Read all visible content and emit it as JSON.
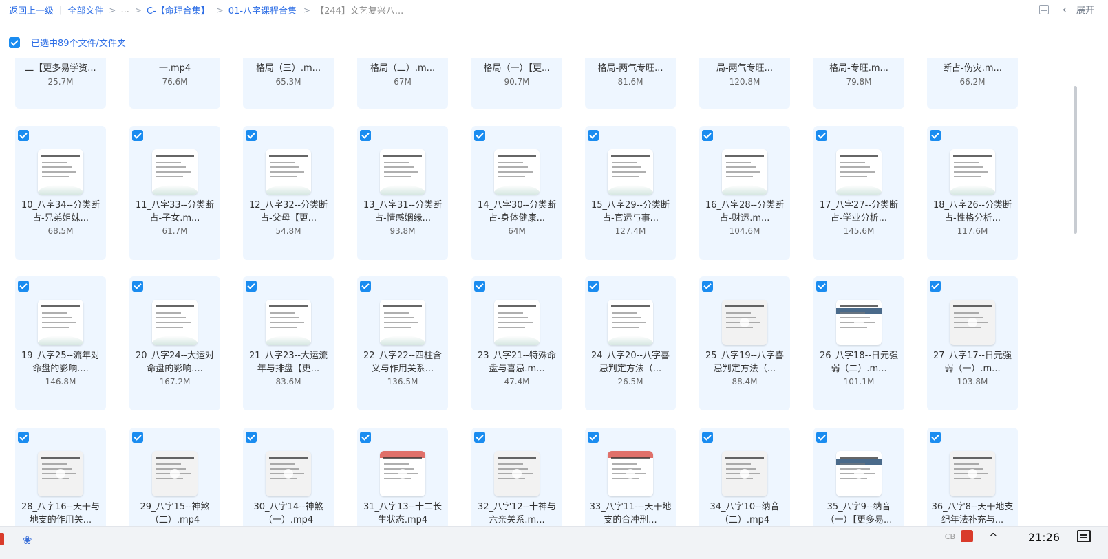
{
  "breadcrumb": {
    "back": "返回上一级",
    "all_files": "全部文件",
    "ellipsis": "...",
    "folder1": "C-【命理合集】",
    "folder2": "01-八字课程合集",
    "current": "【244】文艺复兴八..."
  },
  "toolbar": {
    "expand_label": "展开"
  },
  "selection": {
    "label": "已选中89个文件/文件夹"
  },
  "partial_row": [
    {
      "name": "二【更多易学资...",
      "size": "25.7M"
    },
    {
      "name": "一.mp4",
      "size": "76.6M"
    },
    {
      "name": "格局（三）.m...",
      "size": "65.3M"
    },
    {
      "name": "格局（二）.m...",
      "size": "67M"
    },
    {
      "name": "格局（一）【更...",
      "size": "90.7M"
    },
    {
      "name": "格局-两气专旺...",
      "size": "81.6M"
    },
    {
      "name": "局-两气专旺...",
      "size": "120.8M"
    },
    {
      "name": "格局-专旺.m...",
      "size": "79.8M"
    },
    {
      "name": "断占-伤灾.m...",
      "size": "66.2M"
    }
  ],
  "rows": [
    [
      {
        "name": "10_八字34--分类断占-兄弟姐妹...",
        "size": "68.5M"
      },
      {
        "name": "11_八字33--分类断占-子女.m...",
        "size": "61.7M"
      },
      {
        "name": "12_八字32--分类断占-父母【更...",
        "size": "54.8M"
      },
      {
        "name": "13_八字31--分类断占-情感姻缘...",
        "size": "93.8M"
      },
      {
        "name": "14_八字30--分类断占-身体健康...",
        "size": "64M"
      },
      {
        "name": "15_八字29--分类断占-官运与事...",
        "size": "127.4M"
      },
      {
        "name": "16_八字28--分类断占-财运.m...",
        "size": "104.6M"
      },
      {
        "name": "17_八字27--分类断占-学业分析...",
        "size": "145.6M"
      },
      {
        "name": "18_八字26--分类断占-性格分析...",
        "size": "117.6M"
      }
    ],
    [
      {
        "name": "19_八字25--流年对命盘的影响....",
        "size": "146.8M"
      },
      {
        "name": "20_八字24--大运对命盘的影响....",
        "size": "167.2M"
      },
      {
        "name": "21_八字23--大运流年与排盘【更...",
        "size": "83.6M"
      },
      {
        "name": "22_八字22--四柱含义与作用关系...",
        "size": "136.5M"
      },
      {
        "name": "23_八字21--特殊命盘与喜忌.m...",
        "size": "47.4M"
      },
      {
        "name": "24_八字20--八字喜忌判定方法（...",
        "size": "26.5M"
      },
      {
        "name": "25_八字19--八字喜忌判定方法（...",
        "size": "88.4M"
      },
      {
        "name": "26_八字18--日元强弱（二）.m...",
        "size": "101.1M"
      },
      {
        "name": "27_八字17--日元强弱（一）.m...",
        "size": "103.8M"
      }
    ],
    [
      {
        "name": "28_八字16--天干与地支的作用关...",
        "size": ""
      },
      {
        "name": "29_八字15--神煞（二）.mp4",
        "size": ""
      },
      {
        "name": "30_八字14--神煞（一）.mp4",
        "size": ""
      },
      {
        "name": "31_八字13--十二长生状态.mp4",
        "size": ""
      },
      {
        "name": "32_八字12--十神与六亲关系.m...",
        "size": ""
      },
      {
        "name": "33_八字11---天干地支的合冲刑...",
        "size": ""
      },
      {
        "name": "34_八字10--纳音（二）.mp4",
        "size": ""
      },
      {
        "name": "35_八字9--纳音（一）【更多易...",
        "size": ""
      },
      {
        "name": "36_八字8--天干地支纪年法补充与...",
        "size": ""
      }
    ]
  ],
  "taskbar": {
    "time": "21:26",
    "caret": "^",
    "lang": "CB"
  },
  "colors": {
    "accent": "#2f6fe6",
    "card_bg": "#eef6ff",
    "checkbox": "#1a8cf0"
  }
}
